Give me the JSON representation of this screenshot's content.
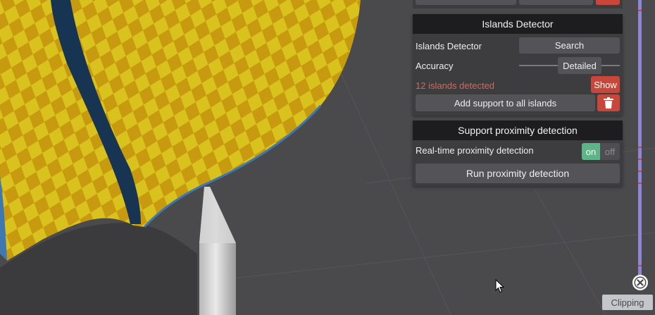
{
  "islands": {
    "title": "Islands Detector",
    "detector_label": "Islands Detector",
    "search_label": "Search",
    "accuracy_label": "Accuracy",
    "accuracy_value": "Detailed",
    "detected_text": "12 islands detected",
    "show_label": "Show",
    "add_support_label": "Add support to all islands"
  },
  "proximity": {
    "title": "Support proximity detection",
    "realtime_label": "Real-time proximity detection",
    "toggle_on": "on",
    "toggle_off": "off",
    "toggle_state": "on",
    "run_label": "Run proximity detection"
  },
  "clipping": {
    "label": "Clipping"
  },
  "colors": {
    "accent_red": "#c8473a",
    "toggle_green": "#5fb487",
    "clip_bar": "#8e84d8",
    "model_yellow": "#d9c21e",
    "model_orange": "#c79a10"
  },
  "icons": [
    "trash-icon",
    "close-circle-icon",
    "cursor-icon"
  ]
}
